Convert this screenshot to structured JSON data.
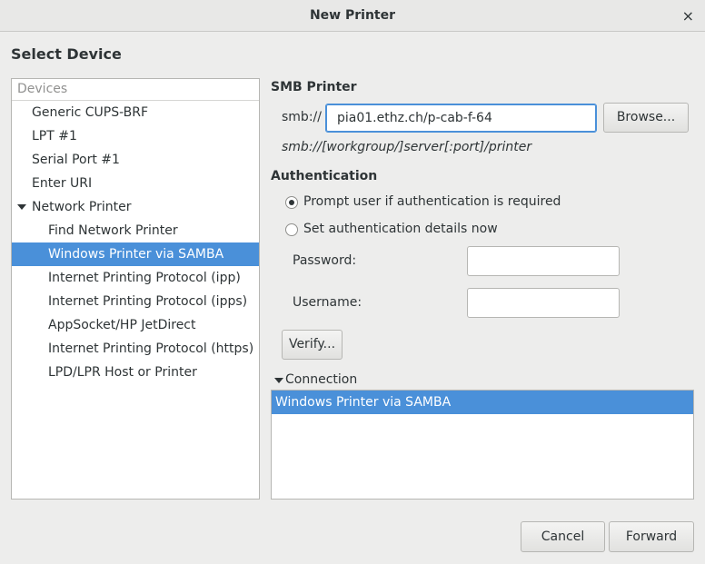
{
  "window": {
    "title": "New Printer",
    "close_glyph": "×"
  },
  "page": {
    "heading": "Select Device"
  },
  "devices": {
    "header": "Devices",
    "items": [
      {
        "label": "Generic CUPS-BRF"
      },
      {
        "label": "LPT #1"
      },
      {
        "label": "Serial Port #1"
      },
      {
        "label": "Enter URI"
      },
      {
        "label": "Network Printer"
      },
      {
        "label": "Find Network Printer"
      },
      {
        "label": "Windows Printer via SAMBA"
      },
      {
        "label": "Internet Printing Protocol (ipp)"
      },
      {
        "label": "Internet Printing Protocol (ipps)"
      },
      {
        "label": "AppSocket/HP JetDirect"
      },
      {
        "label": "Internet Printing Protocol (https)"
      },
      {
        "label": "LPD/LPR Host or Printer"
      }
    ]
  },
  "smb": {
    "title": "SMB Printer",
    "prefix": "smb://",
    "value": "pia01.ethz.ch/p-cab-f-64",
    "browse_label": "Browse...",
    "hint": "smb://[workgroup/]server[:port]/printer"
  },
  "auth": {
    "title": "Authentication",
    "option_prompt": "Prompt user if authentication is required",
    "option_set": "Set authentication details now",
    "password_label": "Password:",
    "password_value": "",
    "username_label": "Username:",
    "username_value": "",
    "verify_label": "Verify..."
  },
  "connection": {
    "title": "Connection",
    "items": [
      {
        "label": "Windows Printer via SAMBA"
      }
    ]
  },
  "footer": {
    "cancel_label": "Cancel",
    "forward_label": "Forward"
  },
  "colors": {
    "selection": "#4a90d9",
    "background": "#ededec"
  }
}
